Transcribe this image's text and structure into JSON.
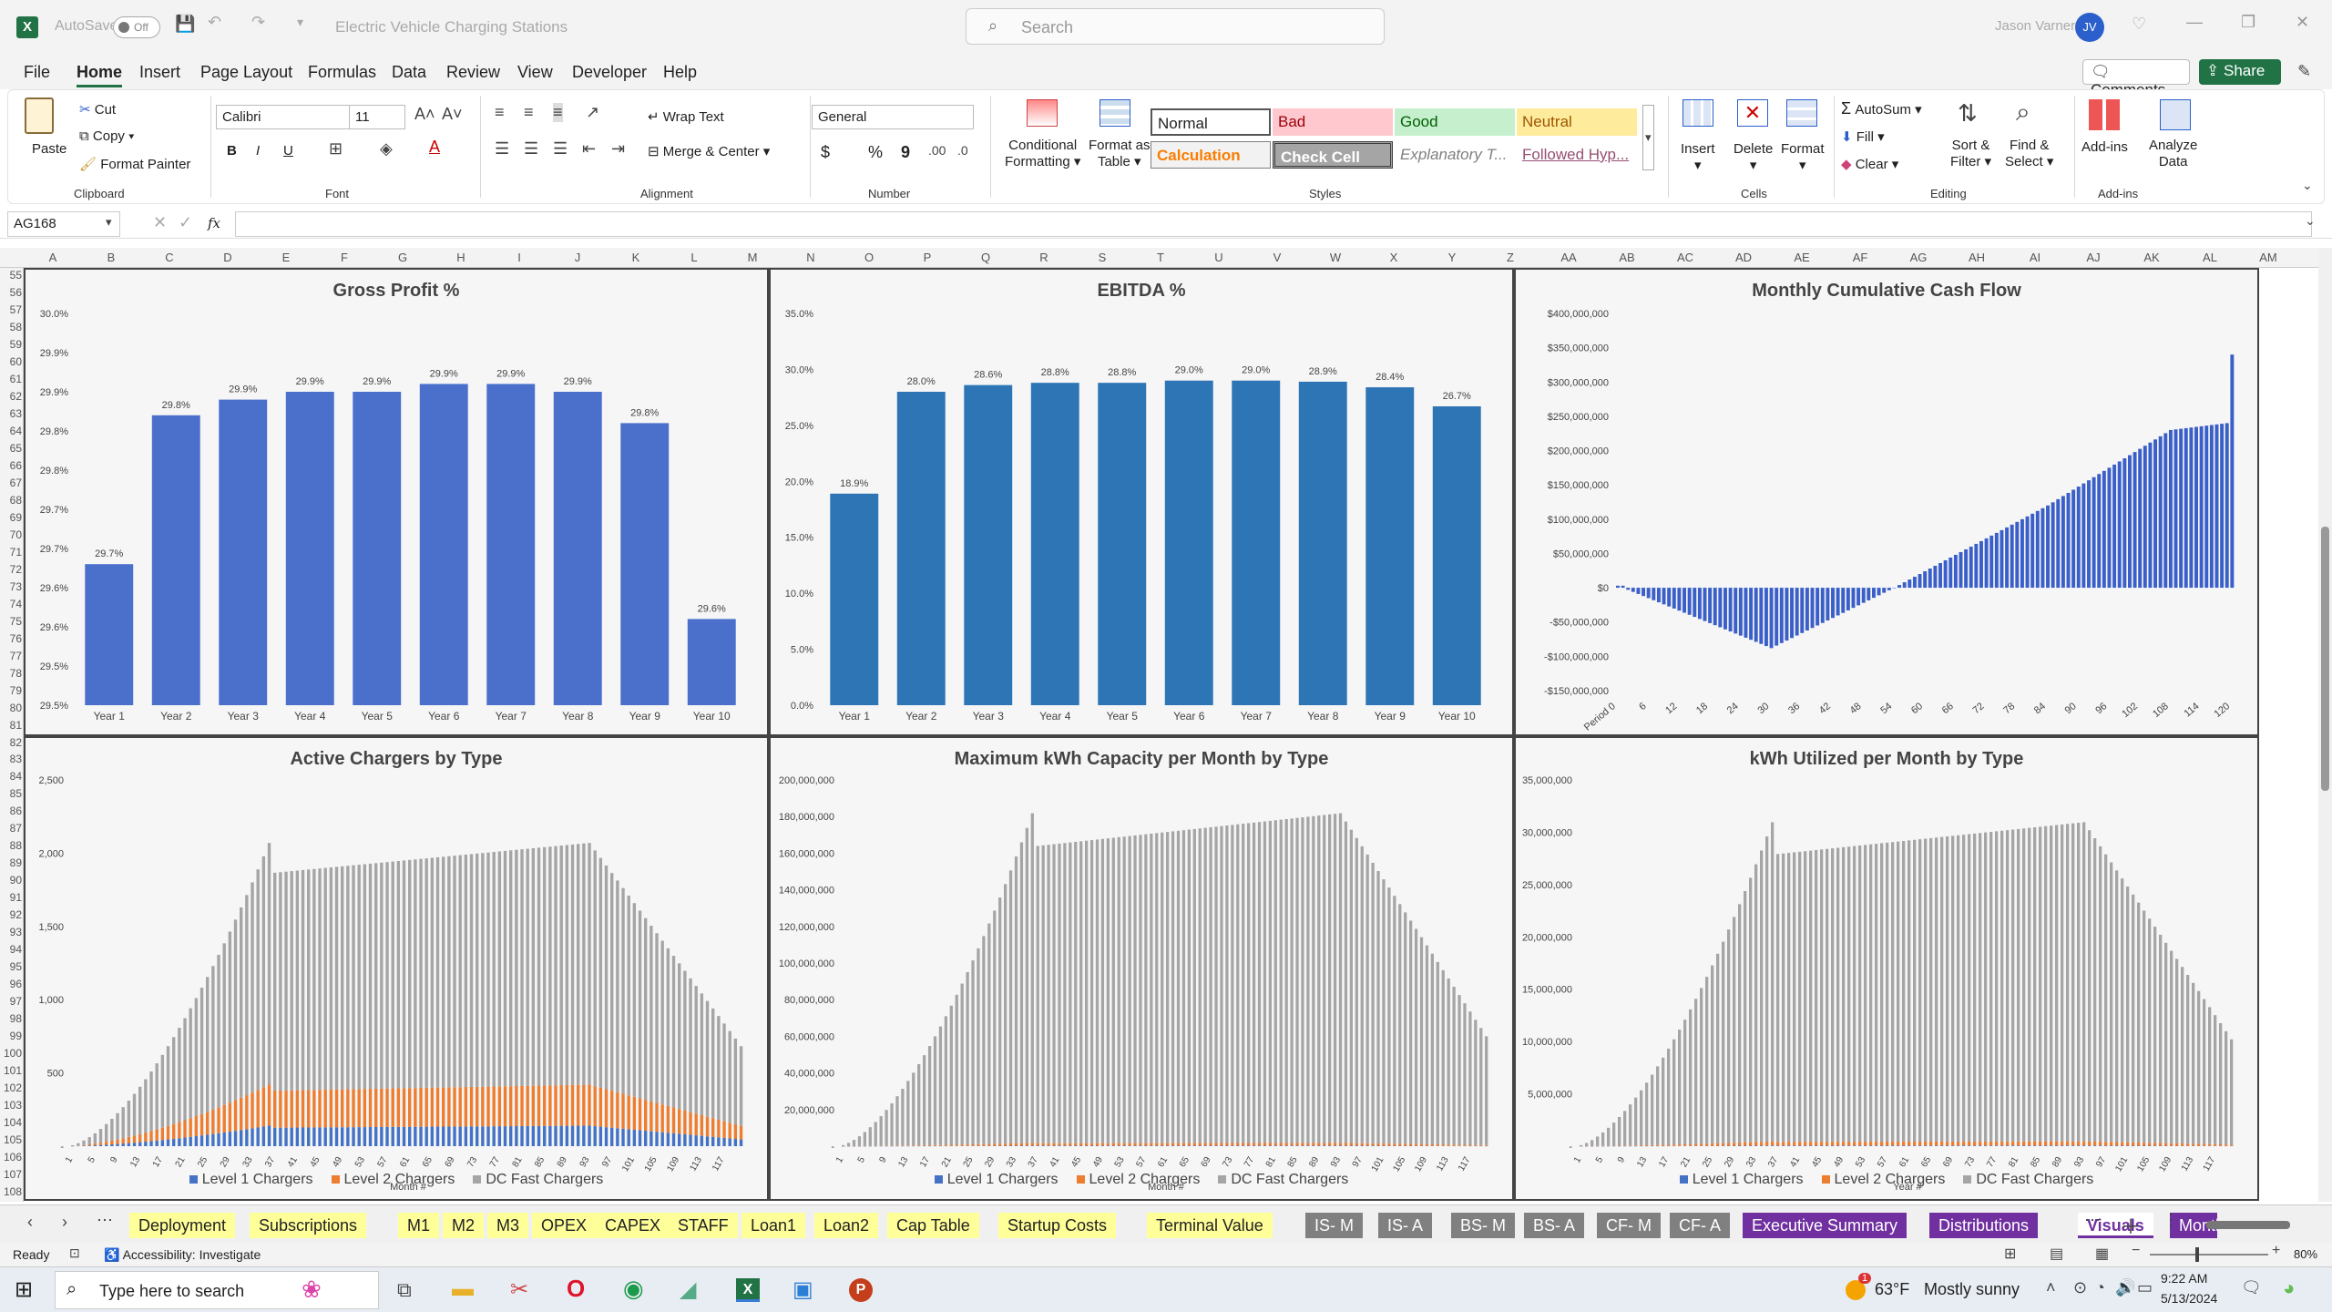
{
  "titlebar": {
    "autosave": "AutoSave",
    "autosave_state": "Off",
    "file_name": "Electric Vehicle Charging Stations",
    "search_placeholder": "Search",
    "user": "Jason Varner",
    "user_initials": "JV"
  },
  "menu": {
    "items": [
      "File",
      "Home",
      "Insert",
      "Page Layout",
      "Formulas",
      "Data",
      "Review",
      "View",
      "Developer",
      "Help"
    ],
    "comments": "Comments",
    "share": "Share"
  },
  "ribbon": {
    "paste": "Paste",
    "cut": "Cut",
    "copy": "Copy",
    "format_painter": "Format Painter",
    "clipboard": "Clipboard",
    "font_name": "Calibri",
    "font_size": "11",
    "font": "Font",
    "bold": "B",
    "italic": "I",
    "underline": "U",
    "wrap_text": "Wrap Text",
    "merge_center": "Merge & Center",
    "alignment": "Alignment",
    "number_format": "General",
    "number": "Number",
    "currency": "$",
    "percent": "%",
    "comma": "9",
    "conditional": "Conditional",
    "formatting": "Formatting",
    "format_as": "Format as",
    "table": "Table",
    "styles": {
      "normal": "Normal",
      "bad": "Bad",
      "good": "Good",
      "neutral": "Neutral",
      "calculation": "Calculation",
      "check_cell": "Check Cell",
      "explanatory": "Explanatory T...",
      "followed": "Followed Hyp..."
    },
    "styles_label": "Styles",
    "insert": "Insert",
    "delete": "Delete",
    "format": "Format",
    "cells": "Cells",
    "autosum": "AutoSum",
    "fill": "Fill",
    "clear": "Clear",
    "sort": "Sort &",
    "filter": "Filter",
    "find": "Find &",
    "select": "Select",
    "editing": "Editing",
    "addins": "Add-ins",
    "analyze": "Analyze",
    "data": "Data",
    "addins_label": "Add-ins"
  },
  "formula_bar": {
    "name_box": "AG168",
    "fx": "fx",
    "value": ""
  },
  "columns": [
    "A",
    "B",
    "C",
    "D",
    "E",
    "F",
    "G",
    "H",
    "I",
    "J",
    "K",
    "L",
    "M",
    "N",
    "O",
    "P",
    "Q",
    "R",
    "S",
    "T",
    "U",
    "V",
    "W",
    "X",
    "Y",
    "Z",
    "AA",
    "AB",
    "AC",
    "AD",
    "AE",
    "AF",
    "AG",
    "AH",
    "AI",
    "AJ",
    "AK",
    "AL",
    "AM"
  ],
  "rows": [
    "55",
    "56",
    "57",
    "58",
    "59",
    "60",
    "61",
    "62",
    "63",
    "64",
    "65",
    "66",
    "67",
    "68",
    "69",
    "70",
    "71",
    "72",
    "73",
    "74",
    "75",
    "76",
    "77",
    "78",
    "79",
    "80",
    "81",
    "82",
    "83",
    "84",
    "85",
    "86",
    "87",
    "88",
    "89",
    "90",
    "91",
    "92",
    "93",
    "94",
    "95",
    "96",
    "97",
    "98",
    "99",
    "100",
    "101",
    "102",
    "103",
    "104",
    "105",
    "106",
    "107",
    "108"
  ],
  "colors": {
    "accent": "#217346",
    "gross_bar": "#4472c4",
    "ebitda_bar": "#2e75b6",
    "l1": "#4472c4",
    "l2": "#ed7d31",
    "dc": "#a5a5a5",
    "tab_yellow": "#ffff99",
    "tab_gray": "#808080",
    "tab_purple": "#7030a0"
  },
  "chart_data": [
    {
      "type": "bar",
      "title": "Gross Profit %",
      "categories": [
        "Year 1",
        "Year 2",
        "Year 3",
        "Year 4",
        "Year 5",
        "Year 6",
        "Year 7",
        "Year 8",
        "Year 9",
        "Year 10"
      ],
      "values": [
        29.7,
        29.8,
        29.9,
        29.9,
        29.9,
        29.9,
        29.9,
        29.9,
        29.8,
        29.6
      ],
      "plot_values": [
        29.68,
        29.87,
        29.89,
        29.9,
        29.9,
        29.91,
        29.91,
        29.9,
        29.86,
        29.61
      ],
      "data_labels": [
        "29.7%",
        "29.8%",
        "29.9%",
        "29.9%",
        "29.9%",
        "29.9%",
        "29.9%",
        "29.9%",
        "29.8%",
        "29.6%"
      ],
      "yticks": [
        "30.0%",
        "29.9%",
        "29.9%",
        "29.8%",
        "29.8%",
        "29.7%",
        "29.7%",
        "29.6%",
        "29.6%",
        "29.5%",
        "29.5%"
      ],
      "ylim": [
        29.5,
        30.0
      ]
    },
    {
      "type": "bar",
      "title": "EBITDA %",
      "categories": [
        "Year 1",
        "Year 2",
        "Year 3",
        "Year 4",
        "Year 5",
        "Year 6",
        "Year 7",
        "Year 8",
        "Year 9",
        "Year 10"
      ],
      "values": [
        18.9,
        28.0,
        28.6,
        28.8,
        28.8,
        29.0,
        29.0,
        28.9,
        28.4,
        26.7
      ],
      "data_labels": [
        "18.9%",
        "28.0%",
        "28.6%",
        "28.8%",
        "28.8%",
        "29.0%",
        "29.0%",
        "28.9%",
        "28.4%",
        "26.7%"
      ],
      "yticks": [
        "35.0%",
        "30.0%",
        "25.0%",
        "20.0%",
        "15.0%",
        "10.0%",
        "5.0%",
        "0.0%"
      ],
      "ylim": [
        0,
        35
      ]
    },
    {
      "type": "bar",
      "title": "Monthly Cumulative Cash Flow",
      "x_ticks": [
        "Period 0",
        "6",
        "12",
        "18",
        "24",
        "30",
        "36",
        "42",
        "48",
        "54",
        "60",
        "66",
        "72",
        "78",
        "84",
        "90",
        "96",
        "102",
        "108",
        "114",
        "120"
      ],
      "yticks": [
        "$400,000,000",
        "$350,000,000",
        "$300,000,000",
        "$250,000,000",
        "$200,000,000",
        "$150,000,000",
        "$100,000,000",
        "$50,000,000",
        "$0",
        "-$50,000,000",
        "-$100,000,000",
        "-$150,000,000"
      ],
      "ylim": [
        -150000000,
        400000000
      ],
      "key_points": [
        [
          0,
          3000000
        ],
        [
          1,
          3000000
        ],
        [
          2,
          -3000000
        ],
        [
          30,
          -88000000
        ],
        [
          54,
          0
        ],
        [
          84,
          120000000
        ],
        [
          108,
          230000000
        ],
        [
          119,
          240000000
        ],
        [
          120,
          340000000
        ]
      ]
    },
    {
      "type": "bar",
      "stacked": true,
      "title": "Active Chargers by Type",
      "xlabel": "Month #",
      "x_ticks": [
        "1",
        "5",
        "9",
        "13",
        "17",
        "21",
        "25",
        "29",
        "33",
        "37",
        "41",
        "45",
        "49",
        "53",
        "57",
        "61",
        "65",
        "69",
        "73",
        "77",
        "81",
        "85",
        "89",
        "93",
        "97",
        "101",
        "105",
        "109",
        "113",
        "117"
      ],
      "yticks": [
        "2,500",
        "2,000",
        "1,500",
        "1,000",
        "500",
        "-"
      ],
      "ylim": [
        0,
        2500
      ],
      "series": [
        {
          "name": "Level 1 Chargers",
          "plateau": 140
        },
        {
          "name": "Level 2 Chargers",
          "plateau": 280
        },
        {
          "name": "DC Fast Chargers",
          "plateau": 1650
        }
      ],
      "ramp_end_month": 36,
      "decline_start_month": 93
    }
  ],
  "chart_data_2": {
    "type": "bar",
    "stacked": true,
    "title": "Maximum kWh Capacity per Month by Type",
    "xlabel": "Month #",
    "x_ticks": [
      "1",
      "5",
      "9",
      "13",
      "17",
      "21",
      "25",
      "29",
      "33",
      "37",
      "41",
      "45",
      "49",
      "53",
      "57",
      "61",
      "65",
      "69",
      "73",
      "77",
      "81",
      "85",
      "89",
      "93",
      "97",
      "101",
      "105",
      "109",
      "113",
      "117"
    ],
    "yticks": [
      "200,000,000",
      "180,000,000",
      "160,000,000",
      "140,000,000",
      "120,000,000",
      "100,000,000",
      "80,000,000",
      "60,000,000",
      "40,000,000",
      "20,000,000",
      "-"
    ],
    "ylim": [
      0,
      200000000
    ],
    "series": [
      {
        "name": "Level 1 Chargers",
        "plateau": 300000
      },
      {
        "name": "Level 2 Chargers",
        "plateau": 1500000
      },
      {
        "name": "DC Fast Chargers",
        "plateau": 180000000
      }
    ],
    "ramp_end_month": 36,
    "decline_start_month": 93
  },
  "chart_data_3": {
    "type": "bar",
    "stacked": true,
    "title": "kWh Utilized per Month by Type",
    "xlabel": "Year #",
    "x_ticks": [
      "1",
      "5",
      "9",
      "13",
      "17",
      "21",
      "25",
      "29",
      "33",
      "37",
      "41",
      "45",
      "49",
      "53",
      "57",
      "61",
      "65",
      "69",
      "73",
      "77",
      "81",
      "85",
      "89",
      "93",
      "97",
      "101",
      "105",
      "109",
      "113",
      "117"
    ],
    "yticks": [
      "35,000,000",
      "30,000,000",
      "25,000,000",
      "20,000,000",
      "15,000,000",
      "10,000,000",
      "5,000,000",
      "-"
    ],
    "ylim": [
      0,
      35000000
    ],
    "series": [
      {
        "name": "Level 1 Chargers",
        "plateau": 60000
      },
      {
        "name": "Level 2 Chargers",
        "plateau": 400000
      },
      {
        "name": "DC Fast Chargers",
        "plateau": 30500000
      }
    ],
    "ramp_end_month": 36,
    "decline_start_month": 93
  },
  "tabs": [
    {
      "label": "Deployment",
      "style": "yellow"
    },
    {
      "label": "Subscriptions",
      "style": "yellow"
    },
    {
      "label": "M1",
      "style": "yellow"
    },
    {
      "label": "M2",
      "style": "yellow"
    },
    {
      "label": "M3",
      "style": "yellow"
    },
    {
      "label": "OPEX",
      "style": "yellow"
    },
    {
      "label": "CAPEX",
      "style": "yellow"
    },
    {
      "label": "STAFF",
      "style": "yellow"
    },
    {
      "label": "Loan1",
      "style": "yellow"
    },
    {
      "label": "Loan2",
      "style": "yellow"
    },
    {
      "label": "Cap Table",
      "style": "yellow"
    },
    {
      "label": "Startup Costs",
      "style": "yellow"
    },
    {
      "label": "Terminal Value",
      "style": "yellow"
    },
    {
      "label": "IS- M",
      "style": "gray"
    },
    {
      "label": "IS- A",
      "style": "gray"
    },
    {
      "label": "BS- M",
      "style": "gray"
    },
    {
      "label": "BS- A",
      "style": "gray"
    },
    {
      "label": "CF- M",
      "style": "gray"
    },
    {
      "label": "CF- A",
      "style": "gray"
    },
    {
      "label": "Executive Summary",
      "style": "purple"
    },
    {
      "label": "Distributions",
      "style": "purple"
    },
    {
      "label": "Visuals",
      "style": "active"
    },
    {
      "label": "Month",
      "style": "purple"
    }
  ],
  "status": {
    "ready": "Ready",
    "accessibility": "Accessibility: Investigate",
    "zoom": "80%"
  },
  "taskbar": {
    "search_placeholder": "Type here to search",
    "weather_temp": "63°F",
    "weather_desc": "Mostly sunny",
    "time": "9:22 AM",
    "date": "5/13/2024",
    "notification": "1"
  }
}
